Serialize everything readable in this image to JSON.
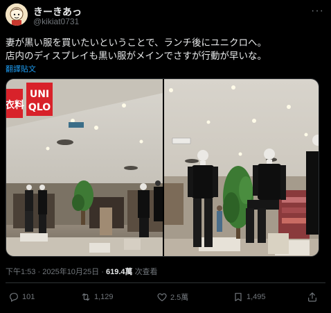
{
  "author": {
    "name": "きーきあっ",
    "handle": "@kikiat0731"
  },
  "tweet": {
    "line1": "妻が黒い服を買いたいということで、ランチ後にユニクロへ。",
    "line2": "店内のディスプレイも黒い服がメインでさすが行動が早いな。",
    "translate": "翻譯貼文"
  },
  "media": {
    "store_logo_line1": "UNI",
    "store_logo_line2": "QLO",
    "store_sign_kanji": "衣料"
  },
  "meta": {
    "time": "下午1:53",
    "date": "2025年10月25日",
    "sep": "·",
    "views_count": "619.4萬",
    "views_label": "次查看"
  },
  "actions": {
    "reply": "101",
    "retweet": "1,129",
    "like": "2.5萬",
    "bookmark": "1,495"
  }
}
